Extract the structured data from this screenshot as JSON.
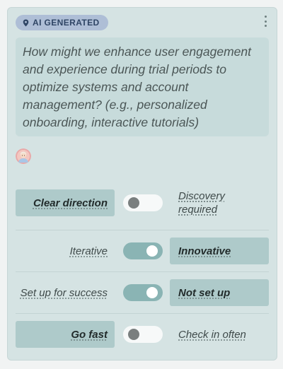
{
  "badge": {
    "icon": "location-pin-icon",
    "label": "AI GENERATED"
  },
  "menu": {
    "icon": "more-vertical-icon"
  },
  "question": {
    "text": "How might we enhance user engagement and experience during trial periods to optimize systems and account management? (e.g., personalized onboarding, interactive tutorials)"
  },
  "avatar": {
    "icon": "user-avatar-icon"
  },
  "rows": [
    {
      "left": "Clear direction",
      "right_line1": "Discovery",
      "right_line2": "required",
      "state": "off",
      "selected": "left"
    },
    {
      "left": "Iterative",
      "right": "Innovative",
      "state": "on",
      "selected": "right"
    },
    {
      "left": "Set up for success",
      "right": "Not set up",
      "state": "on",
      "selected": "right"
    },
    {
      "left": "Go fast",
      "right": "Check in often",
      "state": "off",
      "selected": "left"
    }
  ],
  "colors": {
    "card_bg": "#d5e3e3",
    "question_bg": "#c7dbdb",
    "badge_bg": "#aebed6",
    "selected_bg": "#aecaca",
    "toggle_on": "#8ab4b4",
    "toggle_off": "#f7f9f9"
  }
}
